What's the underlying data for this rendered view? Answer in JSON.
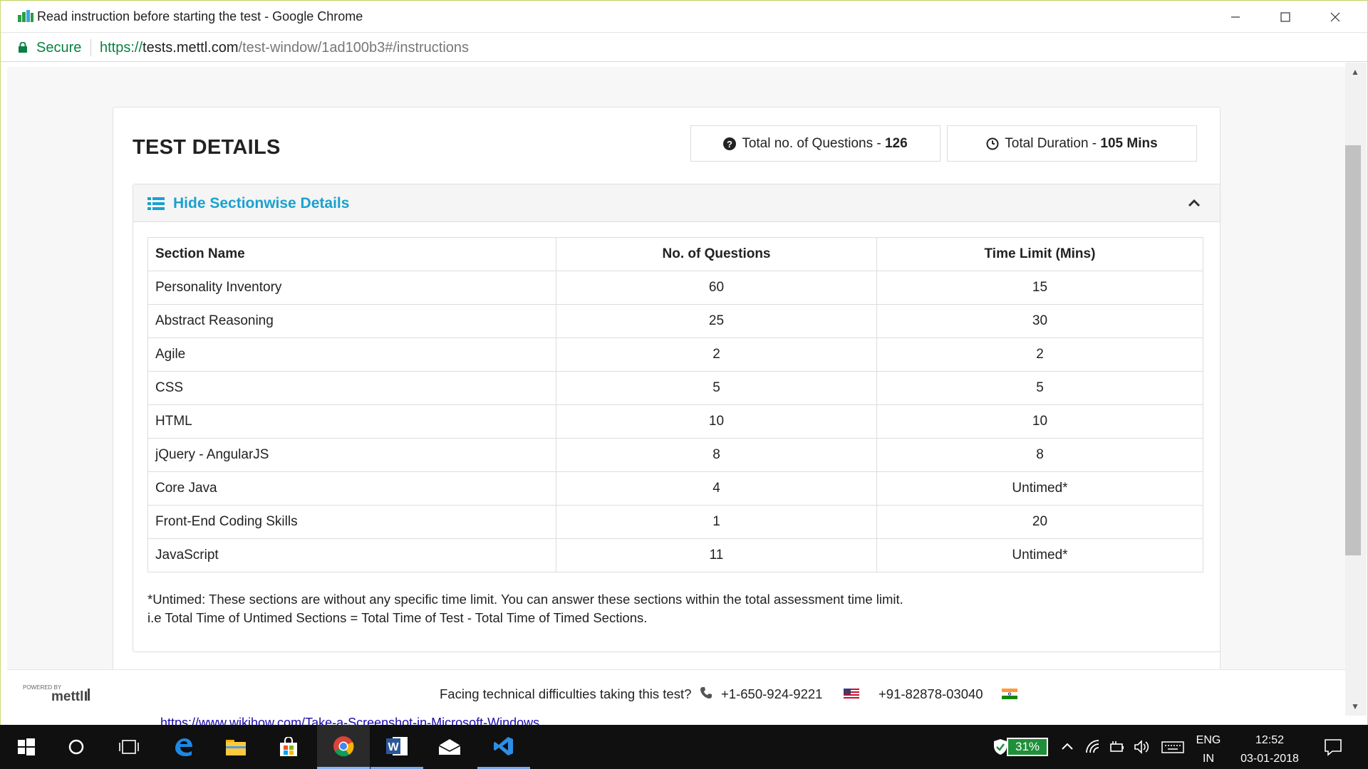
{
  "window": {
    "title": "Read instruction before starting the test - Google Chrome",
    "secure_label": "Secure",
    "url_scheme": "https://",
    "url_host": "tests.mettl.com",
    "url_path": "/test-window/1ad100b3#/instructions",
    "colors": {
      "accent_green": "#0b8043",
      "frame_green": "#b9d45a"
    }
  },
  "test": {
    "title": "TEST DETAILS",
    "questions_label": "Total no. of Questions - ",
    "questions_value": "126",
    "duration_label": "Total Duration - ",
    "duration_value": "105 Mins"
  },
  "sections_panel": {
    "toggle_label": "Hide Sectionwise Details",
    "title_color": "#1aa1cf",
    "columns": [
      "Section Name",
      "No. of Questions",
      "Time Limit (Mins)"
    ],
    "rows": [
      {
        "name": "Personality Inventory",
        "questions": "60",
        "time": "15"
      },
      {
        "name": "Abstract Reasoning",
        "questions": "25",
        "time": "30"
      },
      {
        "name": "Agile",
        "questions": "2",
        "time": "2"
      },
      {
        "name": "CSS",
        "questions": "5",
        "time": "5"
      },
      {
        "name": "HTML",
        "questions": "10",
        "time": "10"
      },
      {
        "name": "jQuery - AngularJS",
        "questions": "8",
        "time": "8"
      },
      {
        "name": "Core Java",
        "questions": "4",
        "time": "Untimed*"
      },
      {
        "name": "Front-End Coding Skills",
        "questions": "1",
        "time": "20"
      },
      {
        "name": "JavaScript",
        "questions": "11",
        "time": "Untimed*"
      }
    ],
    "note_line1": "*Untimed: These sections are without any specific time limit. You can answer these sections within the total assessment time limit.",
    "note_line2": "i.e Total Time of Untimed Sections = Total Time of Test - Total Time of Timed Sections."
  },
  "footer": {
    "powered_by": "POWERED BY",
    "brand": "mettl",
    "help_text": "Facing technical difficulties taking this test?",
    "phone_us": "+1-650-924-9221",
    "phone_in": "+91-82878-03040"
  },
  "background_link": "https://www.wikihow.com/Take-a-Screenshot-in-Microsoft-Windows",
  "taskbar": {
    "battery": "31%",
    "lang_top": "ENG",
    "lang_bottom": "IN",
    "time": "12:52",
    "date": "03-01-2018",
    "apps": [
      "start-icon",
      "cortana-icon",
      "task-view-icon",
      "edge-icon",
      "file-explorer-icon",
      "store-icon",
      "chrome-icon",
      "word-icon",
      "mail-icon",
      "vscode-icon"
    ]
  }
}
